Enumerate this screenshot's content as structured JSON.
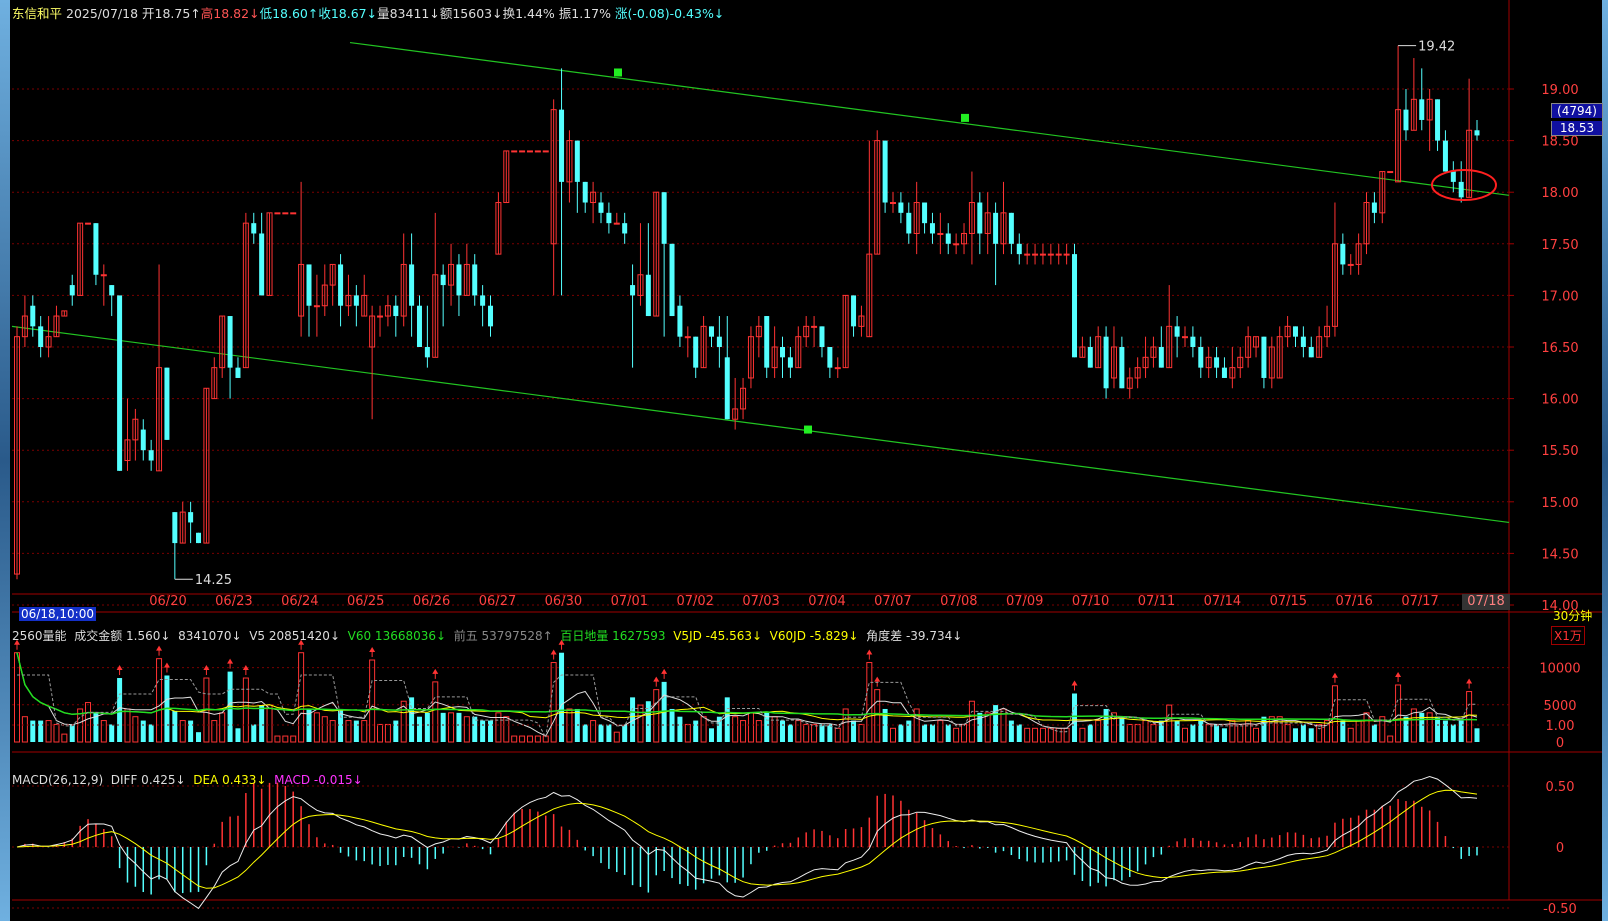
{
  "header": {
    "stock_name": "东信和平",
    "date": "2025/07/18",
    "open": "开18.75↑",
    "high": "高18.82↓",
    "low": "低18.60↑",
    "close": "收18.67↓",
    "volume": "量83411↓",
    "amount": "额15603↓",
    "turnover": "换1.44%",
    "amplitude": "振1.17%",
    "change": "涨(-0.08)-0.43%↓"
  },
  "colors": {
    "up": "#ff3333",
    "down": "#54ffff",
    "channel": "#22c422",
    "grid": "#7a0000",
    "axis": "#a00000",
    "text": "#dddddd",
    "yellow": "#ffff00",
    "magenta": "#ff33ff"
  },
  "price_axis": {
    "ticks": [
      "19.00",
      "18.50",
      "18.00",
      "17.50",
      "17.00",
      "16.50",
      "16.00",
      "15.50",
      "15.00",
      "14.50",
      "14.00"
    ],
    "current_count": "(4794)",
    "current_price": "18.53",
    "period": "30分钟"
  },
  "date_axis": {
    "cursor_label": "06/18,10:00",
    "labels": [
      "06/20",
      "06/23",
      "06/24",
      "06/25",
      "06/26",
      "06/27",
      "06/30",
      "07/01",
      "07/02",
      "07/03",
      "07/04",
      "07/07",
      "07/08",
      "07/09",
      "07/10",
      "07/11",
      "07/14",
      "07/15",
      "07/16",
      "07/17",
      "07/18"
    ]
  },
  "annotations": {
    "high_label": "19.42",
    "low_label": "14.25"
  },
  "volume_panel": {
    "title": "2560量能",
    "amount_label": "成交金额 1.560↓",
    "amount_value": "8341070↓",
    "v5": "V5 20851420↓",
    "v60": "V60 13668036↓",
    "prev5": "前五 53797528↑",
    "baiday": "百日地量 1627593",
    "v5jd": "V5JD -45.563↓",
    "v60jd": "V60JD -5.829↓",
    "angle": "角度差 -39.734↓",
    "unit": "X1万",
    "ticks": [
      "10000",
      "5000",
      "0"
    ]
  },
  "macd_panel": {
    "title": "MACD(26,12,9)",
    "diff": "DIFF 0.425↓",
    "dea": "DEA 0.433↓",
    "macd": "MACD -0.015↓",
    "ticks": [
      "1.00",
      "0.50",
      "0",
      "-0.50"
    ]
  },
  "candles": [
    [
      14.3,
      16.6,
      14.25,
      16.7
    ],
    [
      16.6,
      16.8,
      16.5,
      17.0
    ],
    [
      16.9,
      16.7,
      16.6,
      17.0
    ],
    [
      16.7,
      16.5,
      16.4,
      16.8
    ],
    [
      16.5,
      16.6,
      16.4,
      16.8
    ],
    [
      16.6,
      16.8,
      16.6,
      16.9
    ],
    [
      16.8,
      16.85,
      16.8,
      16.85
    ],
    [
      17.1,
      17.0,
      16.9,
      17.2
    ],
    [
      17.0,
      17.7,
      17.0,
      17.7
    ],
    [
      17.7,
      17.7,
      17.7,
      17.7
    ],
    [
      17.7,
      17.2,
      17.1,
      17.7
    ],
    [
      17.2,
      17.2,
      16.9,
      17.3
    ],
    [
      17.1,
      17.0,
      16.8,
      17.1
    ],
    [
      17.0,
      15.3,
      15.3,
      16.8
    ],
    [
      15.4,
      15.6,
      15.3,
      16.0
    ],
    [
      15.6,
      15.8,
      15.4,
      15.9
    ],
    [
      15.7,
      15.5,
      15.4,
      15.8
    ],
    [
      15.5,
      15.4,
      15.3,
      15.6
    ],
    [
      15.3,
      16.3,
      15.3,
      17.3
    ],
    [
      16.3,
      15.6,
      15.6,
      16.3
    ],
    [
      14.9,
      14.6,
      14.25,
      14.9
    ],
    [
      14.6,
      14.9,
      14.6,
      15.0
    ],
    [
      14.9,
      14.8,
      14.6,
      15.0
    ],
    [
      14.7,
      14.6,
      14.6,
      14.7
    ],
    [
      14.6,
      16.1,
      14.6,
      16.1
    ],
    [
      16.0,
      16.3,
      16.0,
      16.4
    ],
    [
      16.3,
      16.8,
      16.2,
      16.8
    ],
    [
      16.8,
      16.3,
      16.0,
      16.8
    ],
    [
      16.3,
      16.2,
      16.2,
      16.4
    ],
    [
      16.3,
      17.7,
      16.3,
      17.8
    ],
    [
      17.7,
      17.6,
      17.5,
      17.8
    ],
    [
      17.6,
      17.0,
      17.0,
      17.8
    ],
    [
      17.0,
      17.8,
      17.0,
      17.8
    ],
    [
      17.8,
      17.8,
      17.8,
      17.8
    ],
    [
      17.8,
      17.8,
      17.8,
      17.8
    ],
    [
      17.8,
      17.8,
      17.8,
      17.8
    ],
    [
      16.8,
      17.3,
      16.6,
      18.1
    ],
    [
      17.3,
      16.9,
      16.6,
      17.3
    ],
    [
      16.9,
      16.9,
      16.6,
      17.2
    ],
    [
      16.9,
      17.1,
      16.8,
      17.3
    ],
    [
      17.1,
      17.3,
      16.9,
      17.3
    ],
    [
      17.3,
      16.9,
      16.7,
      17.4
    ],
    [
      16.9,
      17.0,
      16.8,
      17.2
    ],
    [
      17.0,
      16.9,
      16.7,
      17.1
    ],
    [
      16.8,
      17.0,
      16.8,
      17.2
    ],
    [
      16.5,
      16.8,
      15.8,
      16.9
    ],
    [
      16.8,
      16.8,
      16.6,
      16.9
    ],
    [
      16.8,
      16.9,
      16.7,
      17.0
    ],
    [
      16.9,
      16.8,
      16.6,
      17.0
    ],
    [
      16.8,
      17.3,
      16.7,
      17.6
    ],
    [
      17.3,
      16.9,
      16.6,
      17.6
    ],
    [
      16.9,
      16.5,
      16.5,
      17.0
    ],
    [
      16.5,
      16.4,
      16.3,
      16.9
    ],
    [
      16.4,
      17.2,
      16.4,
      17.8
    ],
    [
      17.2,
      17.1,
      16.7,
      17.3
    ],
    [
      17.1,
      17.3,
      16.9,
      17.5
    ],
    [
      17.3,
      17.0,
      16.8,
      17.4
    ],
    [
      17.0,
      17.3,
      17.0,
      17.5
    ],
    [
      17.3,
      17.0,
      16.9,
      17.4
    ],
    [
      17.0,
      16.9,
      16.7,
      17.1
    ],
    [
      16.9,
      16.7,
      16.6,
      17.0
    ],
    [
      17.4,
      17.9,
      17.4,
      18.0
    ],
    [
      17.9,
      18.4,
      17.9,
      18.4
    ],
    [
      18.4,
      18.4,
      18.4,
      18.4
    ],
    [
      18.4,
      18.4,
      18.4,
      18.4
    ],
    [
      18.4,
      18.4,
      18.4,
      18.4
    ],
    [
      18.4,
      18.4,
      18.4,
      18.4
    ],
    [
      18.4,
      18.4,
      18.4,
      18.4
    ],
    [
      17.5,
      18.8,
      17.0,
      18.9
    ],
    [
      18.8,
      18.1,
      17.0,
      19.2
    ],
    [
      18.1,
      18.5,
      17.9,
      18.6
    ],
    [
      18.5,
      18.1,
      17.8,
      18.5
    ],
    [
      18.1,
      17.9,
      17.8,
      18.1
    ],
    [
      17.9,
      18.0,
      17.7,
      18.1
    ],
    [
      17.9,
      17.8,
      17.7,
      18.0
    ],
    [
      17.8,
      17.7,
      17.6,
      17.9
    ],
    [
      17.7,
      17.7,
      17.7,
      17.8
    ],
    [
      17.7,
      17.6,
      17.5,
      17.8
    ],
    [
      17.1,
      17.0,
      16.3,
      17.3
    ],
    [
      17.0,
      17.2,
      16.9,
      17.7
    ],
    [
      17.2,
      16.8,
      16.8,
      17.7
    ],
    [
      16.8,
      18.0,
      16.8,
      18.0
    ],
    [
      18.0,
      17.5,
      16.6,
      18.0
    ],
    [
      17.5,
      16.8,
      16.8,
      17.5
    ],
    [
      16.9,
      16.6,
      16.5,
      17.0
    ],
    [
      16.6,
      16.6,
      16.4,
      16.7
    ],
    [
      16.6,
      16.3,
      16.2,
      16.6
    ],
    [
      16.3,
      16.7,
      16.3,
      16.8
    ],
    [
      16.7,
      16.6,
      16.5,
      16.7
    ],
    [
      16.6,
      16.5,
      16.3,
      16.8
    ],
    [
      16.4,
      15.8,
      15.8,
      16.8
    ],
    [
      15.8,
      15.9,
      15.7,
      16.2
    ],
    [
      15.9,
      16.1,
      15.8,
      16.2
    ],
    [
      16.2,
      16.6,
      16.1,
      16.7
    ],
    [
      16.6,
      16.7,
      16.4,
      16.8
    ],
    [
      16.8,
      16.3,
      16.2,
      16.8
    ],
    [
      16.3,
      16.5,
      16.2,
      16.7
    ],
    [
      16.5,
      16.4,
      16.2,
      16.6
    ],
    [
      16.4,
      16.3,
      16.2,
      16.5
    ],
    [
      16.3,
      16.6,
      16.3,
      16.7
    ],
    [
      16.6,
      16.7,
      16.5,
      16.8
    ],
    [
      16.7,
      16.7,
      16.5,
      16.8
    ],
    [
      16.7,
      16.5,
      16.4,
      16.7
    ],
    [
      16.5,
      16.3,
      16.2,
      16.5
    ],
    [
      16.3,
      16.3,
      16.2,
      16.4
    ],
    [
      16.3,
      17.0,
      16.3,
      17.0
    ],
    [
      17.0,
      16.7,
      16.6,
      17.0
    ],
    [
      16.7,
      16.8,
      16.6,
      16.9
    ],
    [
      16.6,
      17.4,
      16.6,
      18.5
    ],
    [
      17.4,
      18.5,
      17.4,
      18.6
    ],
    [
      18.5,
      17.9,
      17.8,
      18.5
    ],
    [
      17.9,
      17.9,
      17.8,
      18.0
    ],
    [
      17.9,
      17.8,
      17.7,
      18.0
    ],
    [
      17.8,
      17.6,
      17.5,
      17.9
    ],
    [
      17.6,
      17.9,
      17.4,
      18.1
    ],
    [
      17.9,
      17.7,
      17.6,
      17.9
    ],
    [
      17.7,
      17.6,
      17.5,
      17.8
    ],
    [
      17.6,
      17.6,
      17.4,
      17.8
    ],
    [
      17.6,
      17.5,
      17.4,
      17.7
    ],
    [
      17.5,
      17.5,
      17.4,
      17.6
    ],
    [
      17.5,
      17.6,
      17.4,
      17.7
    ],
    [
      17.6,
      17.9,
      17.3,
      18.2
    ],
    [
      17.9,
      17.6,
      17.4,
      18.0
    ],
    [
      17.6,
      17.8,
      17.4,
      18.0
    ],
    [
      17.8,
      17.5,
      17.1,
      17.9
    ],
    [
      17.5,
      17.8,
      17.4,
      18.1
    ],
    [
      17.8,
      17.5,
      17.4,
      17.8
    ],
    [
      17.5,
      17.4,
      17.3,
      17.6
    ],
    [
      17.4,
      17.4,
      17.3,
      17.5
    ],
    [
      17.4,
      17.4,
      17.3,
      17.5
    ],
    [
      17.4,
      17.4,
      17.3,
      17.5
    ],
    [
      17.4,
      17.4,
      17.3,
      17.5
    ],
    [
      17.4,
      17.4,
      17.3,
      17.5
    ],
    [
      17.4,
      17.4,
      17.3,
      17.5
    ],
    [
      17.4,
      16.4,
      16.4,
      17.5
    ],
    [
      16.4,
      16.5,
      16.4,
      16.6
    ],
    [
      16.5,
      16.3,
      16.3,
      16.6
    ],
    [
      16.3,
      16.6,
      16.3,
      16.7
    ],
    [
      16.6,
      16.1,
      16.0,
      16.7
    ],
    [
      16.2,
      16.5,
      16.1,
      16.7
    ],
    [
      16.5,
      16.1,
      16.1,
      16.6
    ],
    [
      16.1,
      16.2,
      16.0,
      16.3
    ],
    [
      16.2,
      16.3,
      16.1,
      16.4
    ],
    [
      16.3,
      16.4,
      16.2,
      16.6
    ],
    [
      16.4,
      16.5,
      16.3,
      16.6
    ],
    [
      16.5,
      16.3,
      16.3,
      16.7
    ],
    [
      16.3,
      16.7,
      16.3,
      17.1
    ],
    [
      16.7,
      16.6,
      16.4,
      16.8
    ],
    [
      16.6,
      16.6,
      16.5,
      16.7
    ],
    [
      16.6,
      16.5,
      16.4,
      16.7
    ],
    [
      16.5,
      16.3,
      16.2,
      16.6
    ],
    [
      16.3,
      16.4,
      16.2,
      16.5
    ],
    [
      16.4,
      16.3,
      16.2,
      16.5
    ],
    [
      16.3,
      16.2,
      16.2,
      16.4
    ],
    [
      16.2,
      16.3,
      16.1,
      16.5
    ],
    [
      16.3,
      16.4,
      16.2,
      16.5
    ],
    [
      16.4,
      16.6,
      16.3,
      16.7
    ],
    [
      16.5,
      16.6,
      16.4,
      16.6
    ],
    [
      16.6,
      16.2,
      16.1,
      16.6
    ],
    [
      16.2,
      16.5,
      16.1,
      16.6
    ],
    [
      16.2,
      16.6,
      16.2,
      16.7
    ],
    [
      16.6,
      16.7,
      16.5,
      16.8
    ],
    [
      16.7,
      16.6,
      16.5,
      16.7
    ],
    [
      16.6,
      16.5,
      16.4,
      16.7
    ],
    [
      16.5,
      16.4,
      16.4,
      16.6
    ],
    [
      16.4,
      16.6,
      16.4,
      16.7
    ],
    [
      16.6,
      16.7,
      16.5,
      16.9
    ],
    [
      16.7,
      17.5,
      16.6,
      17.9
    ],
    [
      17.5,
      17.3,
      17.2,
      17.6
    ],
    [
      17.3,
      17.3,
      17.2,
      17.4
    ],
    [
      17.3,
      17.5,
      17.2,
      17.6
    ],
    [
      17.5,
      17.9,
      17.4,
      18.0
    ],
    [
      17.9,
      17.8,
      17.7,
      18.0
    ],
    [
      17.8,
      18.2,
      17.7,
      18.2
    ],
    [
      18.2,
      18.2,
      18.2,
      18.2
    ],
    [
      18.1,
      18.8,
      18.1,
      19.42
    ],
    [
      18.8,
      18.6,
      18.5,
      19.0
    ],
    [
      18.6,
      18.9,
      18.6,
      19.3
    ],
    [
      18.9,
      18.7,
      18.6,
      19.2
    ],
    [
      18.7,
      18.9,
      18.4,
      19.0
    ],
    [
      18.9,
      18.5,
      18.4,
      18.9
    ],
    [
      18.5,
      18.2,
      18.2,
      18.6
    ],
    [
      18.2,
      18.1,
      18.0,
      18.3
    ],
    [
      18.1,
      17.95,
      17.9,
      18.3
    ],
    [
      17.95,
      18.6,
      17.95,
      19.1
    ],
    [
      18.6,
      18.55,
      18.5,
      18.7
    ]
  ]
}
